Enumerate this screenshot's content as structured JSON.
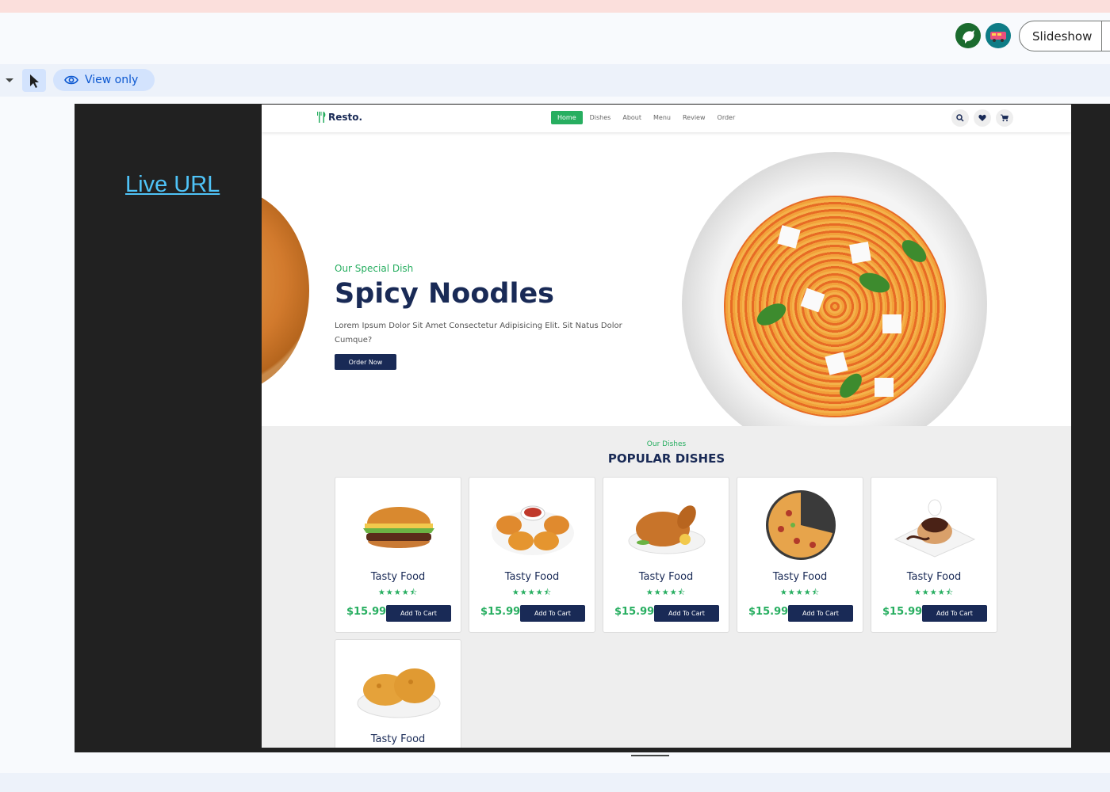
{
  "app": {
    "slideshow_label": "Slideshow",
    "view_only_label": "View only",
    "avatars": [
      "user-avatar-green",
      "user-avatar-teal"
    ]
  },
  "slide": {
    "live_url_label": "Live URL"
  },
  "site": {
    "logo": "Resto.",
    "nav": [
      "Home",
      "Dishes",
      "About",
      "Menu",
      "Review",
      "Order"
    ],
    "active_nav": "Home",
    "nav_icons": [
      "search-icon",
      "heart-icon",
      "cart-icon"
    ],
    "hero": {
      "subtitle": "Our Special Dish",
      "title": "Spicy Noodles",
      "description": "Lorem Ipsum Dolor Sit Amet Consectetur Adipisicing Elit. Sit Natus Dolor Cumque?",
      "button": "Order Now"
    },
    "dishes": {
      "subtitle": "Our Dishes",
      "title": "POPULAR DISHES",
      "cards": [
        {
          "name": "Tasty Food",
          "rating": 4.5,
          "price": "$15.99",
          "button": "Add To Cart",
          "image": "burger"
        },
        {
          "name": "Tasty Food",
          "rating": 4.5,
          "price": "$15.99",
          "button": "Add To Cart",
          "image": "nuggets"
        },
        {
          "name": "Tasty Food",
          "rating": 4.5,
          "price": "$15.99",
          "button": "Add To Cart",
          "image": "roast-chicken"
        },
        {
          "name": "Tasty Food",
          "rating": 4.5,
          "price": "$15.99",
          "button": "Add To Cart",
          "image": "pizza"
        },
        {
          "name": "Tasty Food",
          "rating": 4.5,
          "price": "$15.99",
          "button": "Add To Cart",
          "image": "dessert"
        },
        {
          "name": "Tasty Food",
          "image": "fried-chicken"
        }
      ]
    }
  },
  "colors": {
    "accent_green": "#27ae60",
    "navy": "#192a56",
    "link_blue": "#4fc3f7"
  }
}
